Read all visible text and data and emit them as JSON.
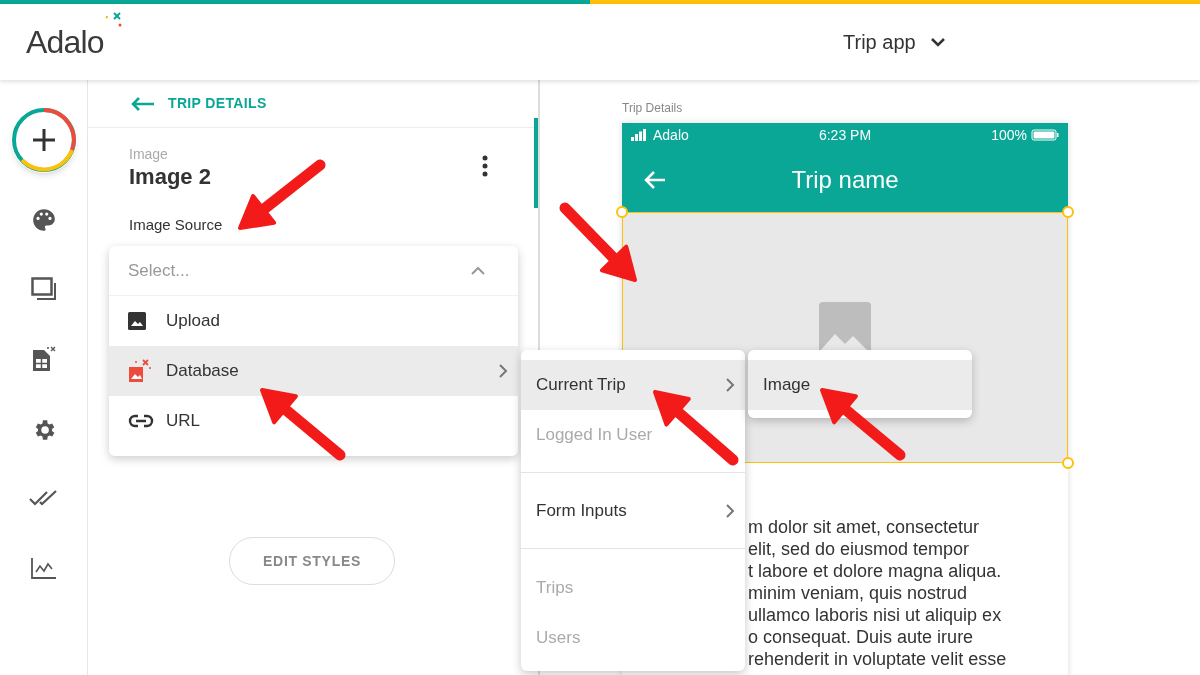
{
  "header": {
    "logo": "Adalo",
    "app_name": "Trip app"
  },
  "panel": {
    "back_label": "TRIP DETAILS",
    "component_type": "Image",
    "component_name": "Image 2",
    "field_label": "Image Source",
    "select": {
      "placeholder": "Select...",
      "expanded": true
    },
    "options": [
      {
        "label": "Upload",
        "kind": "upload",
        "selected": false,
        "has_submenu": false
      },
      {
        "label": "Database",
        "kind": "database",
        "selected": true,
        "has_submenu": true
      },
      {
        "label": "URL",
        "kind": "link",
        "selected": false,
        "has_submenu": false
      }
    ],
    "edit_styles": "EDIT STYLES"
  },
  "canvas": {
    "screen_label": "Trip Details",
    "status_bar": {
      "carrier": "Adalo",
      "time": "6:23 PM",
      "battery": "100%"
    },
    "title": "Trip name",
    "image_selected": true,
    "text_lines": [
      "m dolor sit amet, consectetur",
      "elit, sed do eiusmod tempor",
      "t labore et dolore magna aliqua.",
      "minim veniam, quis nostrud",
      "ullamco laboris nisi ut aliquip ex",
      "o consequat. Duis aute irure",
      "rehenderit in voluptate velit esse"
    ]
  },
  "submenus": [
    {
      "groups": [
        [
          {
            "label": "Current Trip",
            "selected": true,
            "disabled": false,
            "has_submenu": true
          },
          {
            "label": "Logged In User",
            "selected": false,
            "disabled": true,
            "has_submenu": false
          }
        ],
        [
          {
            "label": "Form Inputs",
            "selected": false,
            "disabled": false,
            "has_submenu": true
          }
        ],
        [
          {
            "label": "Trips",
            "selected": false,
            "disabled": true,
            "has_submenu": false
          },
          {
            "label": "Users",
            "selected": false,
            "disabled": true,
            "has_submenu": false
          }
        ]
      ]
    },
    {
      "groups": [
        [
          {
            "label": "Image",
            "selected": true,
            "disabled": false,
            "has_submenu": false
          }
        ]
      ]
    }
  ]
}
